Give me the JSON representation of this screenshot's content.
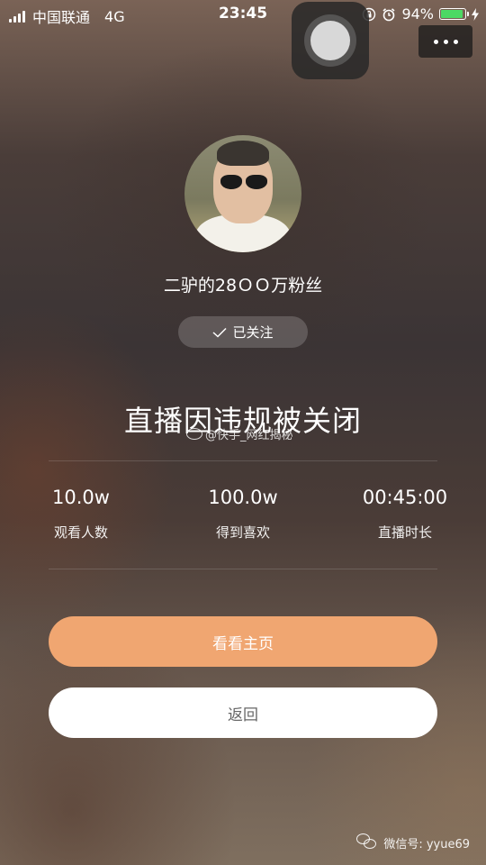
{
  "status_bar": {
    "carrier": "中国联通",
    "network": "4G",
    "time": "23:45",
    "battery": "94%",
    "battery_level": 0.94,
    "icons": [
      "signal-icon",
      "rotation-lock-icon",
      "alarm-icon",
      "battery-icon",
      "charging-icon"
    ]
  },
  "top_bar": {
    "more_icon": "more-dots-icon"
  },
  "profile": {
    "name": "二驴的28ＯＯ万粉丝",
    "follow_label": "已关注",
    "follow_icon": "check-icon"
  },
  "main": {
    "title": "直播因违规被关闭",
    "watermark": "@快手_网红揭秘"
  },
  "stats": [
    {
      "value": "10.0w",
      "label": "观看人数"
    },
    {
      "value": "100.0w",
      "label": "得到喜欢"
    },
    {
      "value": "00:45:00",
      "label": "直播时长"
    }
  ],
  "actions": {
    "home_label": "看看主页",
    "back_label": "返回"
  },
  "footer": {
    "wechat": "微信号: yyue69"
  },
  "colors": {
    "primary_button": "#f0a671",
    "battery_green": "#4cd964"
  }
}
